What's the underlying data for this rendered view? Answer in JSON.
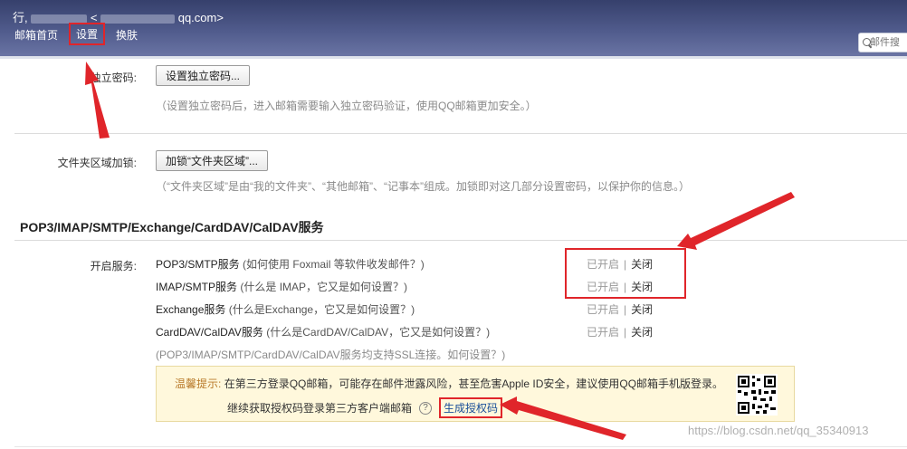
{
  "header": {
    "user_prefix": "行,",
    "user_email_mid": "<",
    "user_email_suffix": "qq.com>",
    "nav": [
      "邮箱首页",
      "设置",
      "换肤"
    ],
    "search_placeholder": "邮件搜"
  },
  "settings": {
    "independent_password": {
      "label": "独立密码:",
      "button": "设置独立密码...",
      "hint": "（设置独立密码后，进入邮箱需要输入独立密码验证，使用QQ邮箱更加安全。）"
    },
    "folder_lock": {
      "label": "文件夹区域加锁:",
      "button": "加锁“文件夹区域”...",
      "hint": "（“文件夹区域”是由“我的文件夹”、“其他邮箱”、“记事本”组成。加锁即对这几部分设置密码，以保护你的信息。）"
    }
  },
  "section_title": "POP3/IMAP/SMTP/Exchange/CardDAV/CalDAV服务",
  "services_label": "开启服务:",
  "services": [
    {
      "name": "POP3/SMTP服务",
      "help": "(如何使用 Foxmail 等软件收发邮件？)",
      "status_on": "已开启",
      "status_off": "关闭"
    },
    {
      "name": "IMAP/SMTP服务",
      "help": "(什么是 IMAP，它又是如何设置？)",
      "status_on": "已开启",
      "status_off": "关闭"
    },
    {
      "name": "Exchange服务",
      "help": "(什么是Exchange，它又是如何设置？)",
      "status_on": "已开启",
      "status_off": "关闭"
    },
    {
      "name": "CardDAV/CalDAV服务",
      "help": "(什么是CardDAV/CalDAV，它又是如何设置？)",
      "status_on": "已开启",
      "status_off": "关闭"
    }
  ],
  "ssl_note": "(POP3/IMAP/SMTP/CardDAV/CalDAV服务均支持SSL连接。如何设置？)",
  "tip": {
    "prefix": "温馨提示:",
    "line1": "在第三方登录QQ邮箱，可能存在邮件泄露风险，甚至危害Apple ID安全，建议使用QQ邮箱手机版登录。",
    "line2": "继续获取授权码登录第三方客户端邮箱",
    "help": "?",
    "link": "生成授权码"
  },
  "watermark": "https://blog.csdn.net/qq_35340913",
  "colors": {
    "annotation_red": "#e0252a",
    "header_top": "#36406c",
    "tip_bg": "#fff8dc"
  }
}
